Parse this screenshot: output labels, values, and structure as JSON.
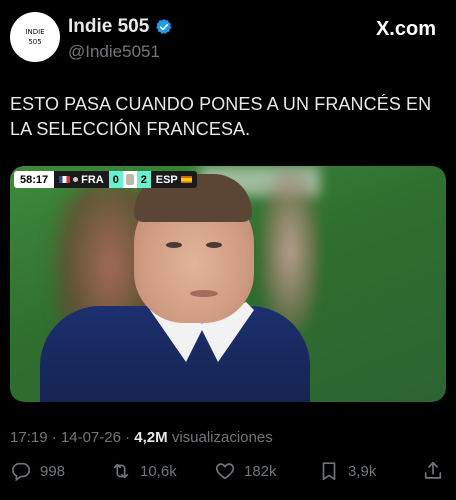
{
  "author": {
    "avatar_line1": "INDIE",
    "avatar_line2": "505",
    "display_name": "Indie 505",
    "handle": "@Indie5051",
    "verified": true
  },
  "brand": "X.com",
  "tweet": {
    "text_line1": "ESTO PASA CUANDO PONES A UN FRANCÉS EN",
    "text_line2": "LA SELECCIÓN FRANCESA."
  },
  "scorebug": {
    "time": "58:17",
    "home": "FRA",
    "home_score": "0",
    "away_score": "2",
    "away": "ESP"
  },
  "meta": {
    "time": "17:19",
    "date": "14-07-26",
    "views_count": "4,2M",
    "views_label": "visualizaciones"
  },
  "actions": {
    "replies": "998",
    "reposts": "10,6k",
    "likes": "182k",
    "bookmarks": "3,9k"
  },
  "colors": {
    "background": "#000000",
    "text": "#e7e9ea",
    "muted": "#71767b",
    "verified": "#1d9bf0"
  }
}
